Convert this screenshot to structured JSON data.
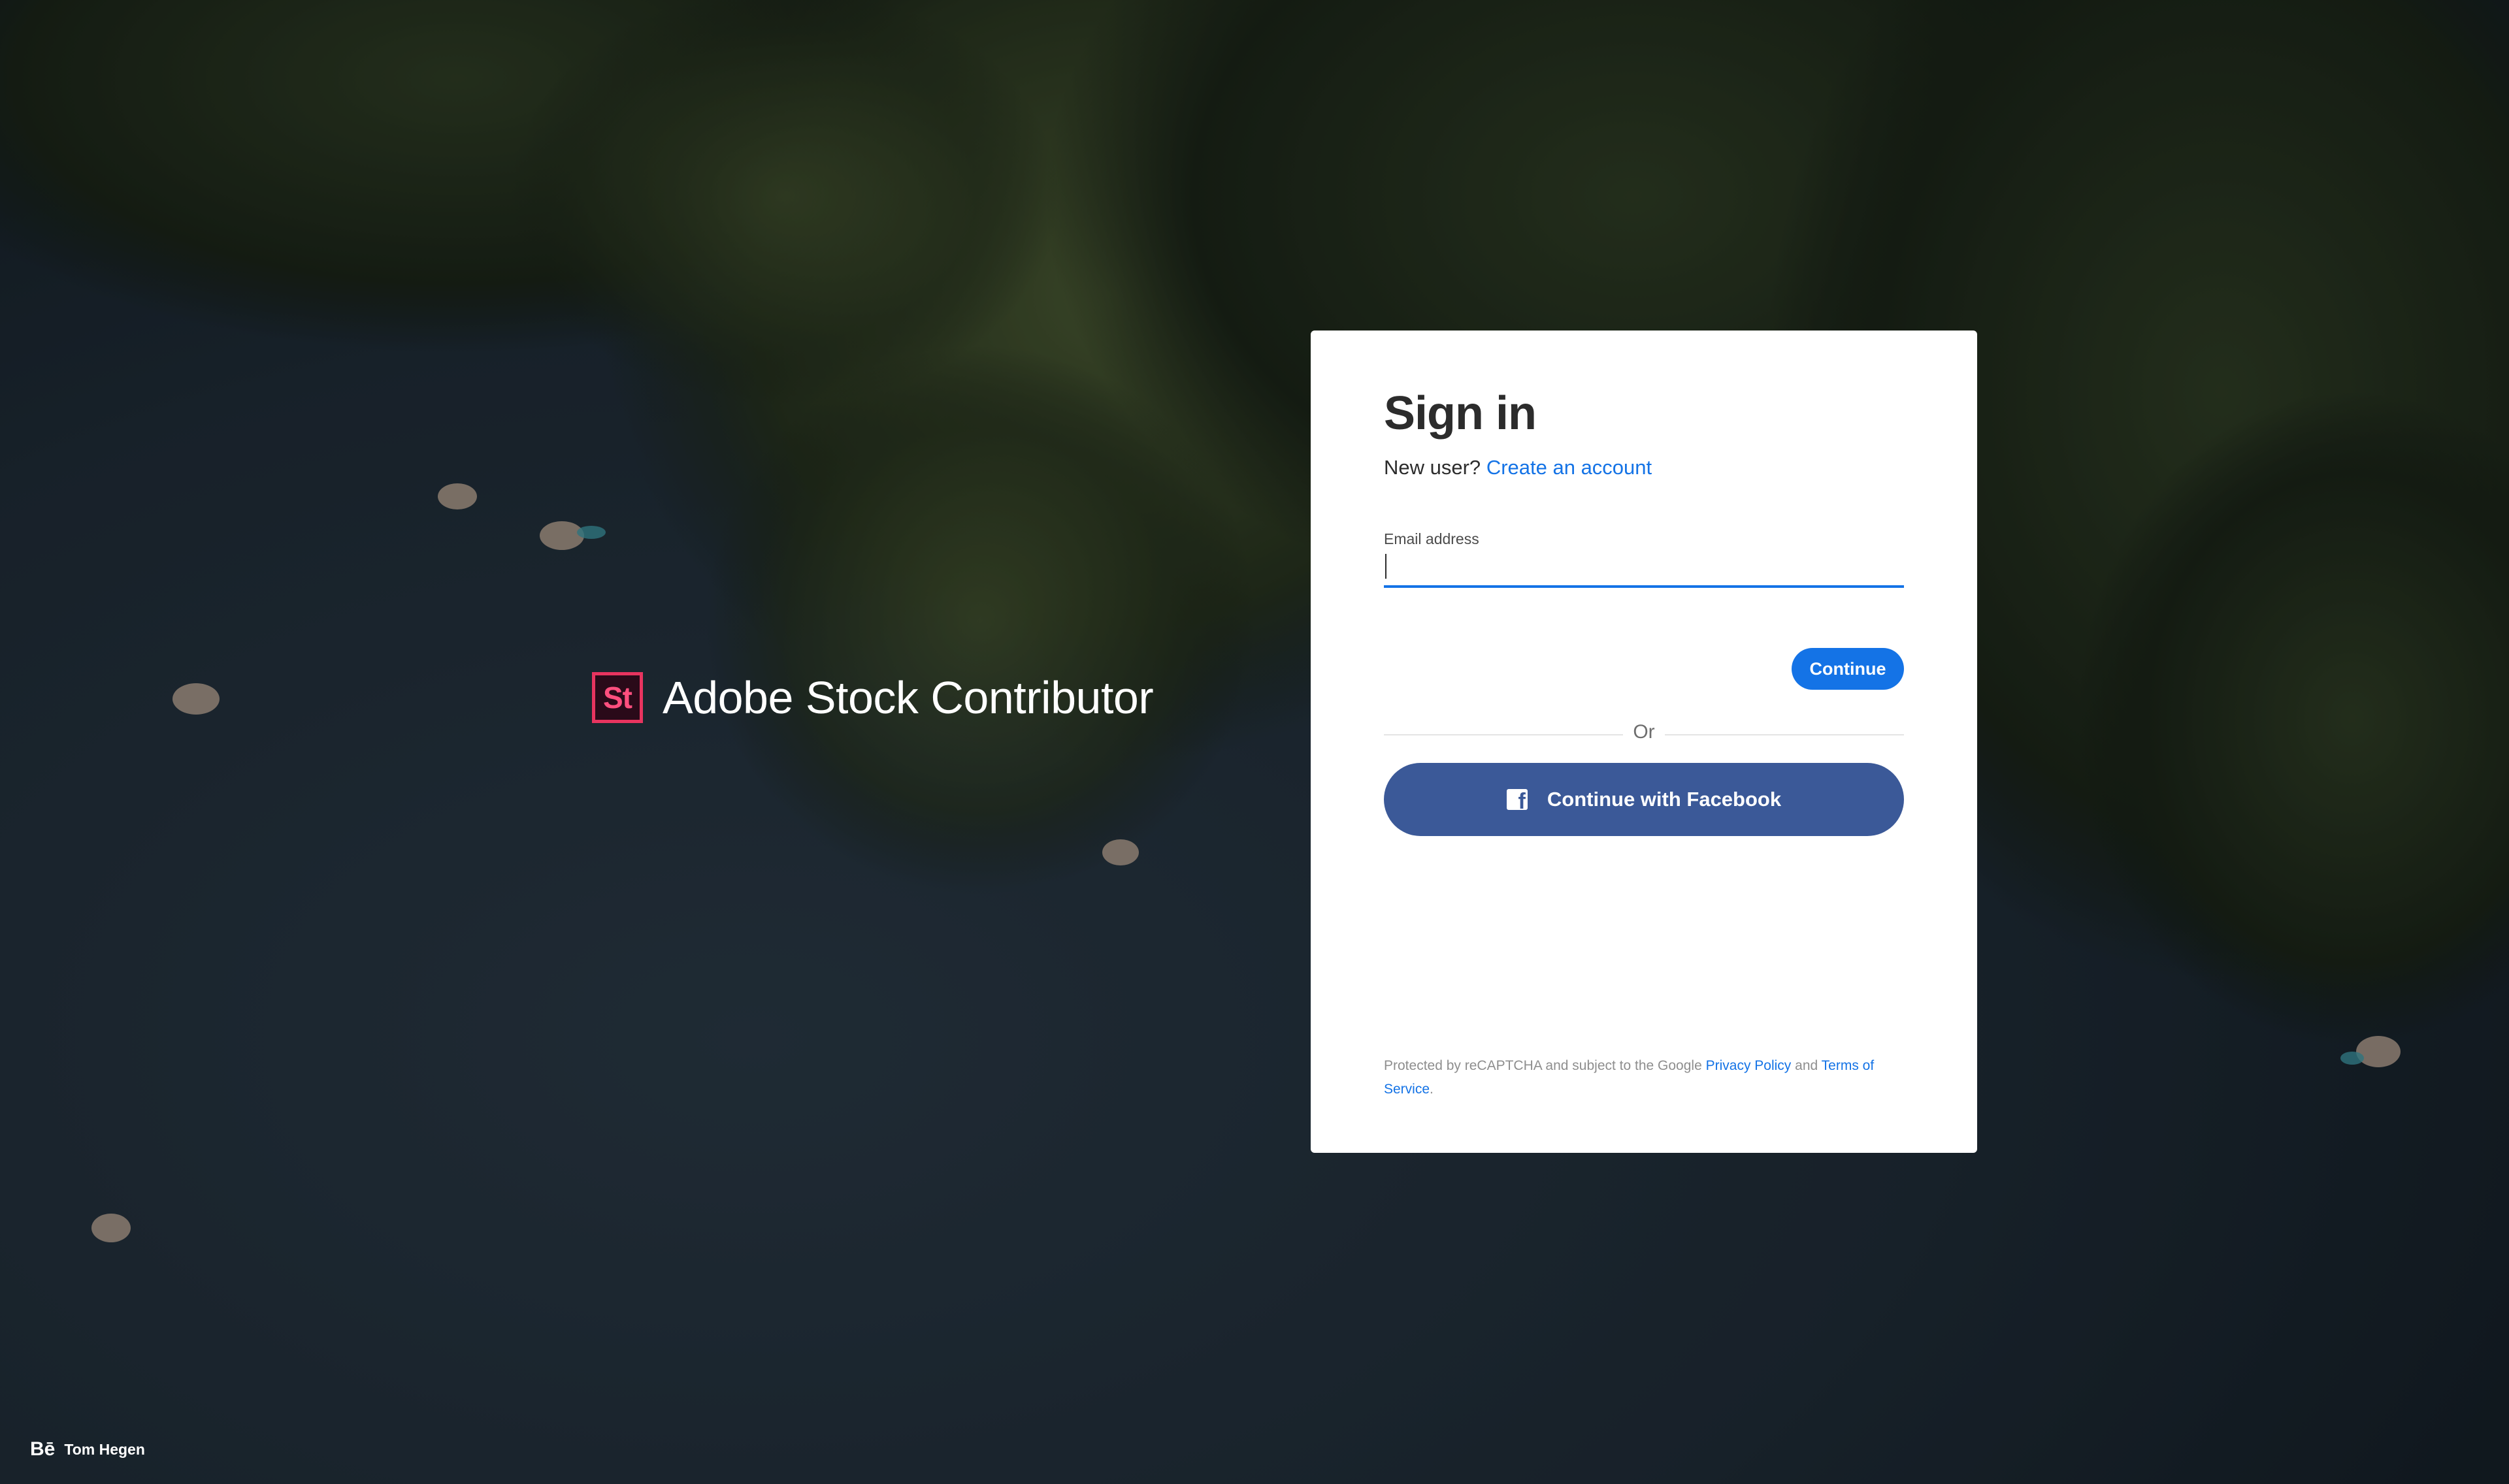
{
  "brand": {
    "logo_text": "St",
    "name": "Adobe Stock Contributor"
  },
  "signin": {
    "title": "Sign in",
    "new_user_text": "New user?",
    "create_account_link": "Create an account",
    "email_label": "Email address",
    "email_value": "",
    "continue_label": "Continue",
    "or_text": "Or",
    "facebook_label": "Continue with Facebook",
    "legal_prefix": "Protected by reCAPTCHA and subject to the Google",
    "privacy_link": "Privacy Policy",
    "legal_and": "and",
    "terms_link": "Terms of Service",
    "legal_suffix": "."
  },
  "credit": {
    "icon_text": "Bē",
    "photographer": "Tom Hegen"
  },
  "colors": {
    "accent": "#1473e6",
    "facebook": "#3b5998",
    "brand_pink": "#e8345f"
  }
}
